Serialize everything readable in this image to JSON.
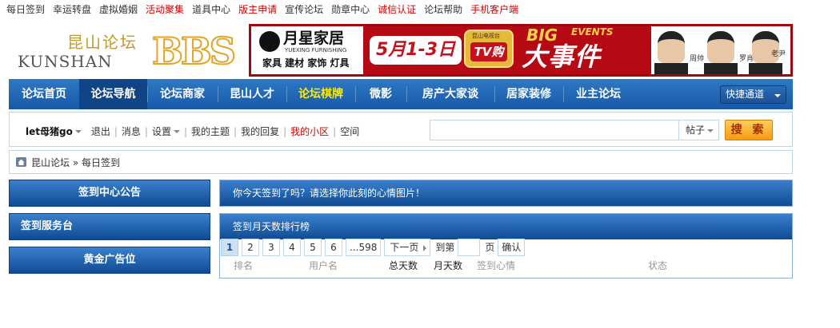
{
  "top_links": [
    {
      "label": "每日签到",
      "red": false
    },
    {
      "label": "幸运转盘",
      "red": false
    },
    {
      "label": "虚拟婚姻",
      "red": false
    },
    {
      "label": "活动聚集",
      "red": true
    },
    {
      "label": "道具中心",
      "red": false
    },
    {
      "label": "版主申请",
      "red": true
    },
    {
      "label": "宣传论坛",
      "red": false
    },
    {
      "label": "勋章中心",
      "red": false
    },
    {
      "label": "诚信认证",
      "red": true
    },
    {
      "label": "论坛帮助",
      "red": false
    },
    {
      "label": "手机客户端",
      "red": true
    }
  ],
  "logo": {
    "cn": "昆山论坛",
    "en": "KUNSHAN",
    "mark": "BBS"
  },
  "banner": {
    "brand": "月星家居",
    "brand_en": "YUEXING FURNISHING",
    "categories": "家具 建材 家饰 灯具",
    "date": "5月1-3日",
    "tv_top": "昆山电视台",
    "tv": "TV购",
    "big": "BIG",
    "events": "EVENTS",
    "event": "大事件",
    "people": [
      "周帅",
      "罗肖",
      "老尹"
    ]
  },
  "nav": {
    "items": [
      {
        "label": "论坛首页",
        "active": false,
        "highlight": false
      },
      {
        "label": "论坛导航",
        "active": true,
        "highlight": false
      },
      {
        "label": "论坛商家",
        "active": false,
        "highlight": false
      },
      {
        "label": "昆山人才",
        "active": false,
        "highlight": false
      },
      {
        "label": "论坛棋牌",
        "active": false,
        "highlight": true
      },
      {
        "label": "微影",
        "active": false,
        "highlight": false
      },
      {
        "label": "房产大家谈",
        "active": false,
        "highlight": false
      },
      {
        "label": "居家装修",
        "active": false,
        "highlight": false
      },
      {
        "label": "业主论坛",
        "active": false,
        "highlight": false
      }
    ],
    "quick_label": "快捷通道"
  },
  "userbar": {
    "username": "let母猪go",
    "links": [
      {
        "label": "退出",
        "red": false,
        "dropdown": false
      },
      {
        "label": "消息",
        "red": false,
        "dropdown": false
      },
      {
        "label": "设置",
        "red": false,
        "dropdown": true
      },
      {
        "label": "我的主题",
        "red": false,
        "dropdown": false
      },
      {
        "label": "我的回复",
        "red": false,
        "dropdown": false
      },
      {
        "label": "我的小区",
        "red": true,
        "dropdown": false
      },
      {
        "label": "空间",
        "red": false,
        "dropdown": false
      }
    ]
  },
  "search": {
    "value": "",
    "type_label": "帖子",
    "button_label": "搜 索"
  },
  "breadcrumb": {
    "home": "昆山论坛",
    "sep": "»",
    "current": "每日签到"
  },
  "left_buttons": {
    "notice": "签到中心公告",
    "service": "签到服务台",
    "ad": "黄金广告位"
  },
  "sign_panel": {
    "title": "你今天签到了吗？请选择你此刻的心情图片！"
  },
  "rank_panel": {
    "title": "签到月天数排行榜",
    "pages": [
      "1",
      "2",
      "3",
      "4",
      "5",
      "6",
      "...598"
    ],
    "next": "下一页",
    "goto_label": "到第",
    "page_unit": "页",
    "confirm": "确认",
    "columns": [
      "排名",
      "用户名",
      "总天数",
      "月天数",
      "签到心情",
      "状态"
    ]
  }
}
